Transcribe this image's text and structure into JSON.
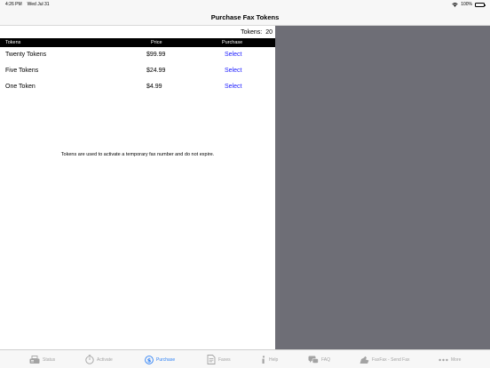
{
  "status_bar": {
    "time": "4:26 PM",
    "date": "Wed Jul 31",
    "battery": "100%"
  },
  "nav": {
    "title": "Purchase Fax Tokens"
  },
  "tokens": {
    "label": "Tokens:",
    "count": "20"
  },
  "table": {
    "headers": {
      "tokens": "Tokens",
      "price": "Price",
      "purchase": "Purchase"
    },
    "rows": [
      {
        "name": "Twenty Tokens",
        "price": "$99.99",
        "action": "Select"
      },
      {
        "name": "Five Tokens",
        "price": "$24.99",
        "action": "Select"
      },
      {
        "name": "One Token",
        "price": "$4.99",
        "action": "Select"
      }
    ]
  },
  "note": "Tokens are used to activate a temporary fax number and do not expire.",
  "tabs": [
    {
      "label": "Status",
      "icon": "fax-machine-icon"
    },
    {
      "label": "Activate",
      "icon": "stopwatch-icon"
    },
    {
      "label": "Purchase",
      "icon": "dollar-icon",
      "active": true
    },
    {
      "label": "Faxes",
      "icon": "document-icon"
    },
    {
      "label": "Help",
      "icon": "info-icon"
    },
    {
      "label": "FAQ",
      "icon": "chat-bubbles-icon"
    },
    {
      "label": "FaxFax - Send Fax",
      "icon": "send-fax-icon"
    },
    {
      "label": "More",
      "icon": "more-dots-icon"
    }
  ],
  "colors": {
    "accent": "#2b7ff5",
    "link": "#1a1aff",
    "detail_bg": "#6e6e76",
    "header_bg": "#000000"
  }
}
